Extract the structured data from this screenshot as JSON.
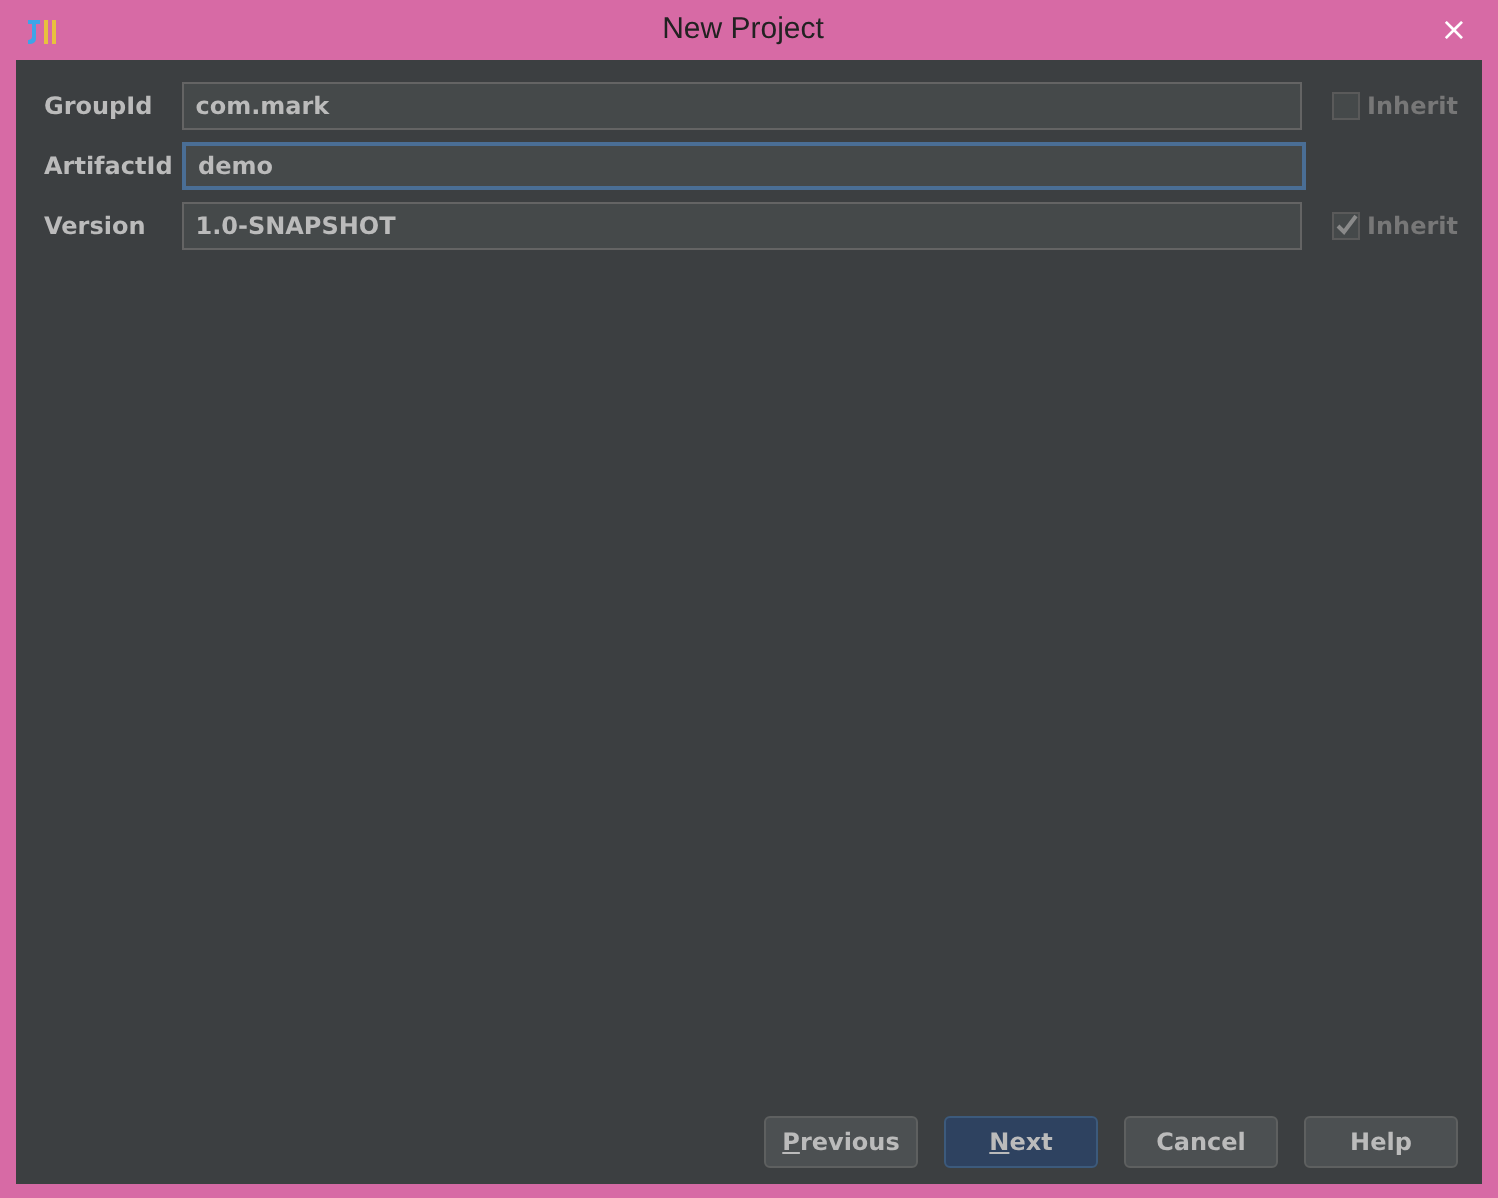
{
  "window": {
    "title": "New Project",
    "close": "×"
  },
  "fields": [
    {
      "label": "GroupId",
      "value": "com.mark",
      "focused": false,
      "inherit": {
        "label": "Inherit",
        "checked": false
      }
    },
    {
      "label": "ArtifactId",
      "value": "demo",
      "focused": true
    },
    {
      "label": "Version",
      "value": "1.0-SNAPSHOT",
      "focused": false,
      "inherit": {
        "label": "Inherit",
        "checked": true
      }
    }
  ],
  "buttons": [
    {
      "label": "Previous",
      "mnemonic": true,
      "default": false
    },
    {
      "label": "Next",
      "mnemonic": true,
      "default": true
    },
    {
      "label": "Cancel",
      "mnemonic": false,
      "default": false
    },
    {
      "label": "Help",
      "mnemonic": false,
      "default": false
    }
  ]
}
